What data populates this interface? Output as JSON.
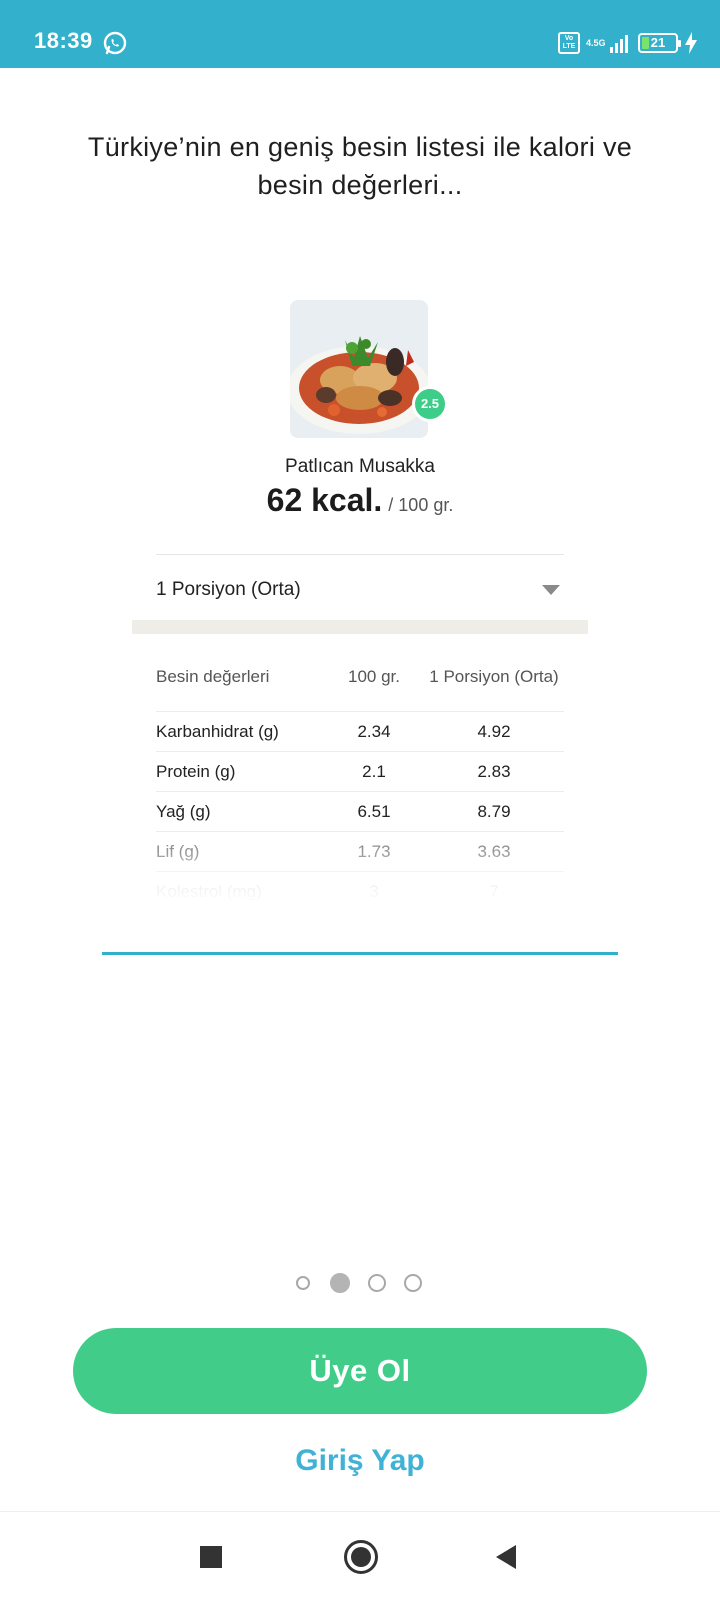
{
  "status_bar": {
    "time": "18:39",
    "notification_icon": "whatsapp-icon",
    "volte_label": "Vo LTE",
    "network_label": "4.5G",
    "battery_level": "21",
    "battery_fraction": 0.21,
    "charging": true,
    "background_color": "#33b1cc"
  },
  "headline": "Türkiye’nin en geniş besin listesi ile kalori ve besin değerleri...",
  "food_card": {
    "image_icon": "eggplant-musakka-photo",
    "score": "2.5",
    "name": "Patlıcan Musakka",
    "kcal": "62 kcal.",
    "per_unit": "/ 100 gr.",
    "portion_select": "1 Porsiyon (Orta)",
    "table": {
      "headers": [
        "Besin değerleri",
        "100 gr.",
        "1 Porsiyon (Orta)"
      ],
      "rows": [
        [
          "Karbanhidrat (g)",
          "2.34",
          "4.92"
        ],
        [
          "Protein (g)",
          "2.1",
          "2.83"
        ],
        [
          "Yağ (g)",
          "6.51",
          "8.79"
        ],
        [
          "Lif (g)",
          "1.73",
          "3.63"
        ],
        [
          "Kolestrol (mg)",
          "3",
          "7"
        ]
      ]
    }
  },
  "pager": {
    "count": 4,
    "active_index": 1
  },
  "buttons": {
    "signup": "Üye Ol",
    "login": "Giriş Yap"
  },
  "colors": {
    "accent_teal": "#33b1cc",
    "primary_green": "#41cd89",
    "link_blue": "#3fb2d6",
    "score_green": "#3dcd88"
  },
  "nav_bar": {
    "recents_icon": "square-icon",
    "home_icon": "circle-home-icon",
    "back_icon": "triangle-back-icon"
  }
}
